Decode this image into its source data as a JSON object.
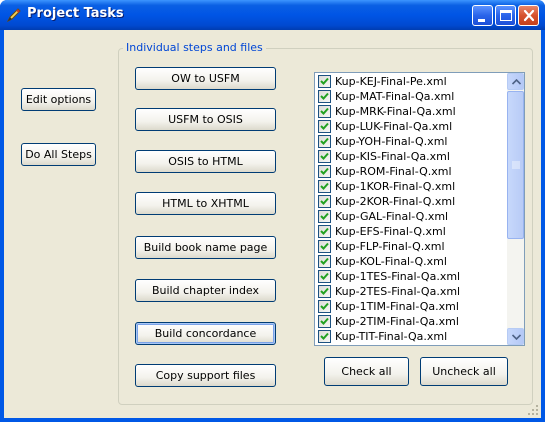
{
  "window": {
    "title": "Project Tasks",
    "controls": {
      "minimize": "minimize",
      "maximize": "maximize",
      "close": "close"
    }
  },
  "left_buttons": {
    "edit_options": "Edit options",
    "do_all_steps": "Do All Steps"
  },
  "group": {
    "legend": "Individual steps and files",
    "steps": [
      {
        "label": "OW to USFM"
      },
      {
        "label": "USFM to OSIS"
      },
      {
        "label": "OSIS to HTML"
      },
      {
        "label": "HTML to XHTML"
      },
      {
        "label": "Build book name page"
      },
      {
        "label": "Build chapter index"
      },
      {
        "label": "Build concordance",
        "focused": true
      },
      {
        "label": "Copy support files"
      }
    ],
    "files": [
      {
        "name": "Kup-KEJ-Final-Pe.xml",
        "checked": true
      },
      {
        "name": "Kup-MAT-Final-Qa.xml",
        "checked": true
      },
      {
        "name": "Kup-MRK-Final-Qa.xml",
        "checked": true
      },
      {
        "name": "Kup-LUK-Final-Qa.xml",
        "checked": true
      },
      {
        "name": "Kup-YOH-Final-Q.xml",
        "checked": true
      },
      {
        "name": "Kup-KIS-Final-Qa.xml",
        "checked": true
      },
      {
        "name": "Kup-ROM-Final-Q.xml",
        "checked": true
      },
      {
        "name": "Kup-1KOR-Final-Q.xml",
        "checked": true
      },
      {
        "name": "Kup-2KOR-Final-Q.xml",
        "checked": true
      },
      {
        "name": "Kup-GAL-Final-Q.xml",
        "checked": true
      },
      {
        "name": "Kup-EFS-Final-Q.xml",
        "checked": true
      },
      {
        "name": "Kup-FLP-Final-Q.xml",
        "checked": true
      },
      {
        "name": "Kup-KOL-Final-Q.xml",
        "checked": true
      },
      {
        "name": "Kup-1TES-Final-Qa.xml",
        "checked": true
      },
      {
        "name": "Kup-2TES-Final-Qa.xml",
        "checked": true
      },
      {
        "name": "Kup-1TIM-Final-Qa.xml",
        "checked": true
      },
      {
        "name": "Kup-2TIM-Final-Qa.xml",
        "checked": true
      },
      {
        "name": "Kup-TIT-Final-Qa.xml",
        "checked": true
      }
    ],
    "check_all": "Check all",
    "uncheck_all": "Uncheck all"
  },
  "colors": {
    "title_bar": "#0055e5",
    "client_background": "#ece9d8",
    "group_legend": "#0046d5",
    "check_mark": "#21a121"
  }
}
